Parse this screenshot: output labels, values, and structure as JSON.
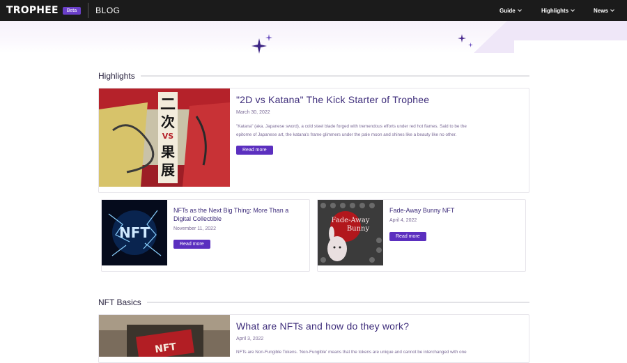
{
  "header": {
    "logo": "TROPHEE",
    "beta": "Beta",
    "section": "BLOG",
    "nav": [
      {
        "label": "Guide"
      },
      {
        "label": "Highlights"
      },
      {
        "label": "News"
      }
    ]
  },
  "highlights": {
    "heading": "Highlights",
    "featured": {
      "title": "\"2D vs Katana\" The Kick Starter of Trophee",
      "date": "March 30, 2022",
      "excerpt_1": "\"Katana\" (aka. Japanese sword), a cold steel blade forged with tremendous efforts under red hot flames. Said to be the",
      "excerpt_2": "epitome of Japanese art, the katana's frame glimmers under the pale moon and shines like a beauty like no other.",
      "button": "Read more"
    },
    "cards": [
      {
        "title": "NFTs as the Next Big Thing: More Than a Digital Collectible",
        "title_line1": "NFTs as the Next Big Thing: More Than a",
        "title_line2": "Digital Collectible",
        "date": "November 11, 2022",
        "button": "Read more",
        "image_text": "NFT"
      },
      {
        "title": "Fade-Away Bunny NFT",
        "date": "April 4, 2022",
        "button": "Read more",
        "image_text_1": "Fade-Away",
        "image_text_2": "Bunny"
      }
    ]
  },
  "nft_basics": {
    "heading": "NFT Basics",
    "featured": {
      "title": "What are NFTs and how do they work?",
      "date": "April 3, 2022",
      "excerpt": "NFTs are Non-Fungible Tokens. 'Non-Fungible' means that the tokens are unique and cannot be interchanged with one"
    }
  },
  "colors": {
    "accent": "#5b2fbf",
    "title": "#3d2c7a",
    "navbar": "#1b1b1b"
  }
}
